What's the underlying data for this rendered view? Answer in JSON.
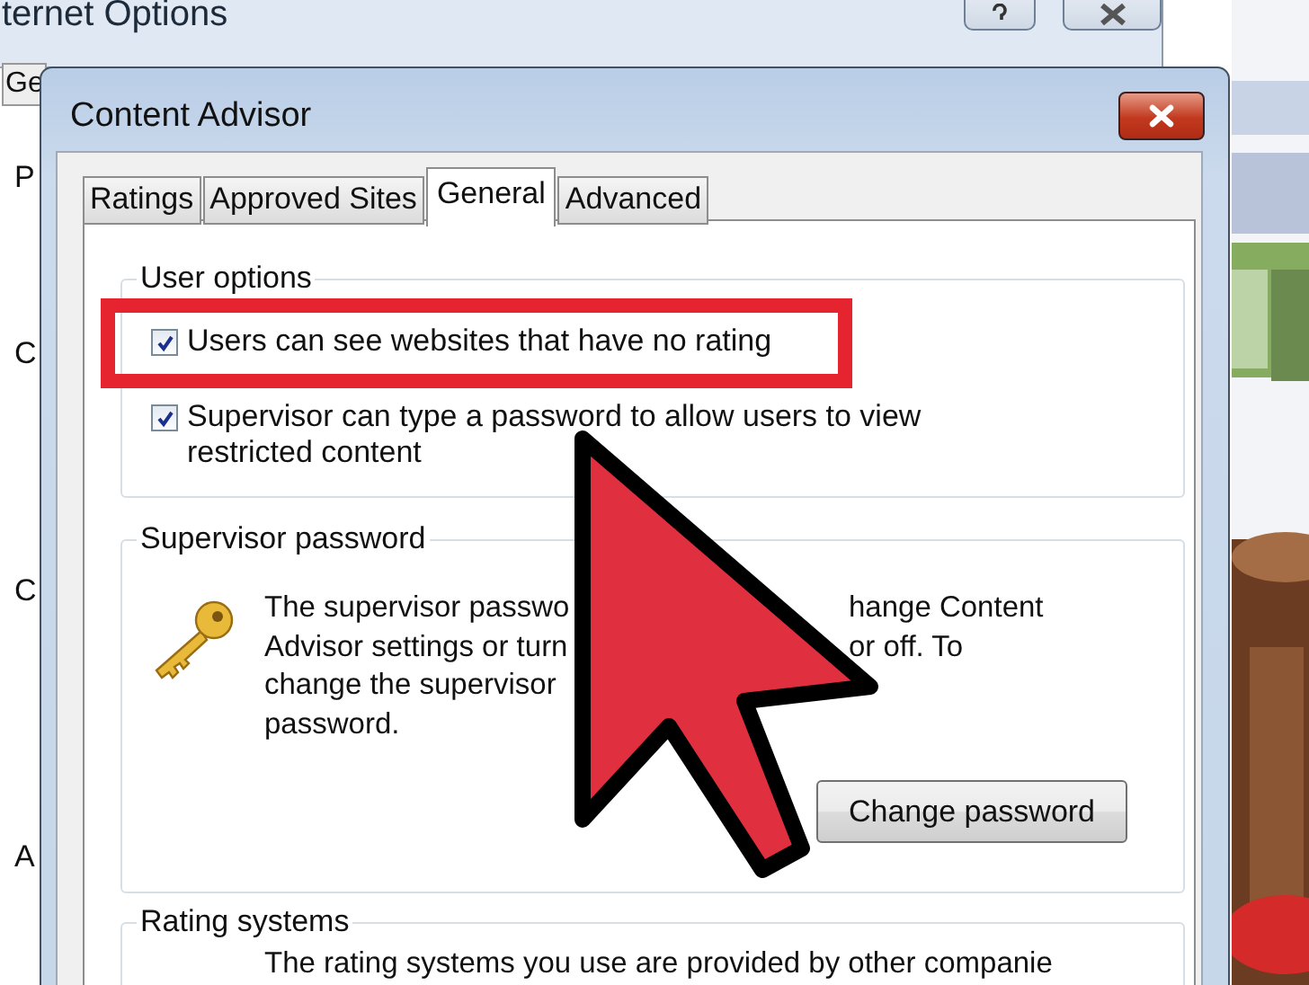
{
  "background_window": {
    "title": "ternet Options",
    "tab": "Ge",
    "labels": [
      "P",
      "C",
      "C",
      "A"
    ]
  },
  "dialog": {
    "title": "Content Advisor",
    "tabs": [
      {
        "label": "Ratings",
        "selected": false
      },
      {
        "label": "Approved Sites",
        "selected": false
      },
      {
        "label": "General",
        "selected": true
      },
      {
        "label": "Advanced",
        "selected": false
      }
    ]
  },
  "user_options": {
    "title": "User options",
    "options": [
      {
        "label": "Users can see websites that have no rating",
        "checked": true
      },
      {
        "label": "Supervisor can type a password to allow users to view restricted content",
        "checked": true
      }
    ]
  },
  "supervisor_password": {
    "title": "Supervisor password",
    "description_lines": [
      [
        "The supervisor passwo",
        "hange Content"
      ],
      [
        "Advisor settings or turn",
        "or off. To"
      ],
      [
        "change the supervisor"
      ],
      [
        "password."
      ]
    ],
    "button": "Change password"
  },
  "rating_systems": {
    "title": "Rating systems",
    "description": "The rating systems you use are provided by other companie"
  }
}
